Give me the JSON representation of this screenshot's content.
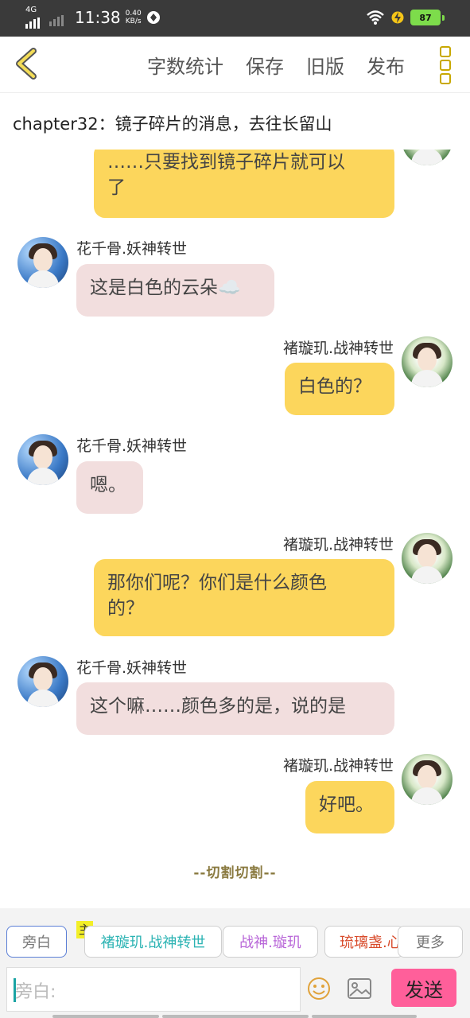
{
  "status_bar": {
    "network": "4G",
    "time": "11:38",
    "speed_value": "0.40",
    "speed_unit": "KB/s",
    "battery": "87"
  },
  "toolbar": {
    "word_count": "字数统计",
    "save": "保存",
    "old_version": "旧版",
    "publish": "发布"
  },
  "chapter_title": "chapter32：镜子碎片的消息，去往长留山",
  "messages": [
    {
      "side": "right",
      "name": "",
      "text_lines": [
        "……只要找到镜子碎片就可以",
        "了"
      ]
    },
    {
      "side": "left",
      "name": "花千骨.妖神转世",
      "text_lines": [
        "这是白色的云朵☁️"
      ]
    },
    {
      "side": "right",
      "name": "褚璇玑.战神转世",
      "text_lines": [
        "白色的？"
      ]
    },
    {
      "side": "left",
      "name": "花千骨.妖神转世",
      "text_lines": [
        "嗯。"
      ]
    },
    {
      "side": "right",
      "name": "褚璇玑.战神转世",
      "text_lines": [
        "那你们呢？你们是什么颜色",
        "的？"
      ]
    },
    {
      "side": "left",
      "name": "花千骨.妖神转世",
      "text_lines": [
        "这个嘛……颜色多的是，说的是"
      ]
    },
    {
      "side": "right",
      "name": "褚璇玑.战神转世",
      "text_lines": [
        "好吧。"
      ]
    }
  ],
  "divider_text": "--切割切割--",
  "roles": {
    "narration": "旁白",
    "main_badge": "主",
    "role1": "褚璇玑.战神转世",
    "role2": "战神.璇玑",
    "role3": "琉璃盏.心",
    "more": "更多"
  },
  "composer": {
    "placeholder": "旁白:",
    "send": "发送"
  },
  "colors": {
    "accent_yellow": "#fcd65c",
    "bubble_pink": "#f2dede",
    "send_pink": "#ff5f9a",
    "role1_color": "#2bb3b3",
    "role2_color": "#b866d8",
    "role3_color": "#d84a2a"
  }
}
